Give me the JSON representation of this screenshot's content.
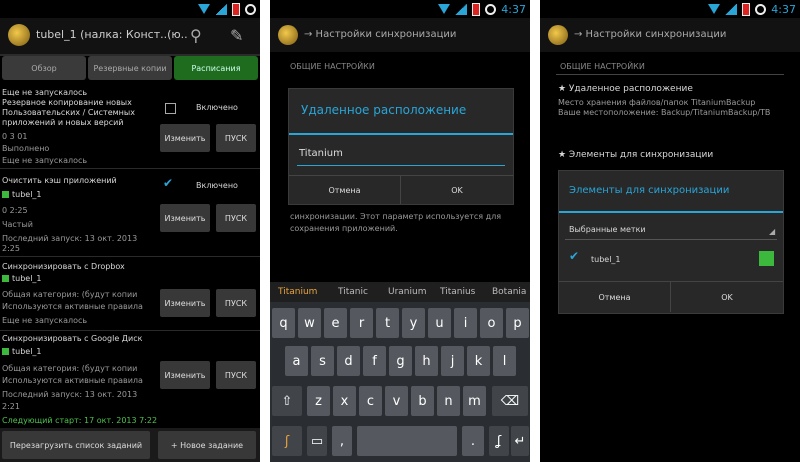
{
  "status": {
    "time_p2": "4:37",
    "time_p3": "4:37"
  },
  "screen1": {
    "title": "tubel_1 (налка: Конст..(ю..",
    "tabs": [
      "Обзор",
      "Резервные копии",
      "Расписания"
    ],
    "block1": {
      "lines": [
        "Резервное копирование новых",
        "Пользовательских / Системных",
        "приложений и новых версий"
      ],
      "time": "0 3 01",
      "status1": "Выполнено",
      "status2": "Еще не запускалось",
      "checkbox_label": "Включено",
      "checked": false
    },
    "block2": {
      "title": "Очистить кэш приложений",
      "item": "tubel_1",
      "time": "0 2:25",
      "kind": "Частый",
      "last_run": "Последний запуск: 13 окт. 2013",
      "last_time": "2:25",
      "checkbox_label": "Включено",
      "checked": true
    },
    "block3": {
      "title": "Синхронизировать с Dropbox",
      "item": "tubel_1",
      "lines": [
        "Общая категория: (будут копии",
        "Используются активные правила",
        "Еще не запускалось"
      ]
    },
    "block4": {
      "title": "Синхронизировать с Google Диск",
      "item": "tubel_1",
      "lines": [
        "Общая категория: (будут копии",
        "Используются активные правила",
        "Последний запуск: 13 окт. 2013",
        "2:21"
      ]
    },
    "next_run": "Следующий старт: 17 окт. 2013 7:22",
    "btn_change": "Изменить",
    "btn_run": "ПУСК",
    "btn_reload": "Перезагрузить список заданий",
    "btn_new": "+ Новое задание"
  },
  "screen2": {
    "crumb": "→ Настройки синхронизации",
    "section": "ОБЩИЕ НАСТРОЙКИ",
    "dialog_title": "Удаленное расположение",
    "input_value": "Titanium",
    "cancel": "Отмена",
    "ok": "OK",
    "bg_text": [
      "синхронизации. Этот параметр используется для",
      "сохранения приложений."
    ],
    "suggestions": [
      "Titanium",
      "Titanic",
      "Uranium",
      "Titanius",
      "Botania"
    ],
    "keys_row1": [
      "q",
      "w",
      "e",
      "r",
      "t",
      "y",
      "u",
      "i",
      "o",
      "p"
    ],
    "keys_row2": [
      "a",
      "s",
      "d",
      "f",
      "g",
      "h",
      "j",
      "k",
      "l"
    ],
    "keys_row3": [
      "z",
      "x",
      "c",
      "v",
      "b",
      "n",
      "m"
    ]
  },
  "screen3": {
    "crumb": "→ Настройки синхронизации",
    "section": "ОБЩИЕ НАСТРОЙКИ",
    "item1_title": "★ Удаленное расположение",
    "item1_lines": [
      "Место хранения файлов/папок TitaniumBackup",
      "Ваше местоположение: Backup/TitaniumBackup/TB"
    ],
    "item2_title": "★ Элементы для синхронизации",
    "dialog_title": "Элементы для синхронизации",
    "dropdown": "Выбранные метки",
    "option": "tubel_1",
    "cancel": "Отмена",
    "ok": "OK"
  },
  "colors": {
    "accent": "#29a5d8",
    "green": "#3cb83c",
    "tab_active": "#1f6c1f"
  }
}
